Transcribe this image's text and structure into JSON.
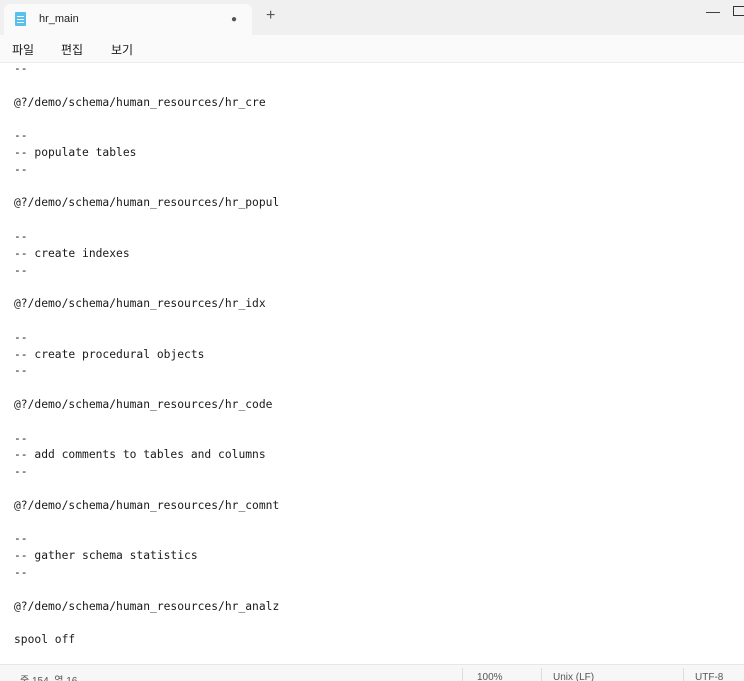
{
  "window": {
    "tab_title": "hr_main",
    "unsaved_indicator": "●",
    "new_tab": "+",
    "minimize": "—",
    "maximize": ""
  },
  "menu": [
    "파일",
    "편집",
    "보기"
  ],
  "editor": {
    "lines": [
      "--",
      "",
      "@?/demo/schema/human_resources/hr_cre",
      "",
      "--",
      "-- populate tables",
      "--",
      "",
      "@?/demo/schema/human_resources/hr_popul",
      "",
      "--",
      "-- create indexes",
      "--",
      "",
      "@?/demo/schema/human_resources/hr_idx",
      "",
      "--",
      "-- create procedural objects",
      "--",
      "",
      "@?/demo/schema/human_resources/hr_code",
      "",
      "--",
      "-- add comments to tables and columns",
      "--",
      "",
      "@?/demo/schema/human_resources/hr_comnt",
      "",
      "--",
      "-- gather schema statistics",
      "--",
      "",
      "@?/demo/schema/human_resources/hr_analz",
      "",
      "spool off"
    ]
  },
  "status": {
    "position": "줄 154, 열 16",
    "zoom": "100%",
    "line_ending": "Unix (LF)",
    "encoding": "UTF-8"
  }
}
